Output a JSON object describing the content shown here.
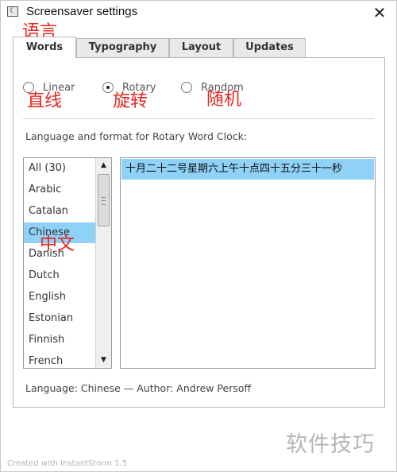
{
  "window": {
    "title": "Screensaver settings",
    "close_glyph": "✕",
    "app_icon": "screensaver-app-icon"
  },
  "tabs": [
    {
      "label": "Words",
      "active": true
    },
    {
      "label": "Typography",
      "active": false
    },
    {
      "label": "Layout",
      "active": false
    },
    {
      "label": "Updates",
      "active": false
    }
  ],
  "mode": {
    "options": [
      {
        "label": "Linear",
        "selected": false
      },
      {
        "label": "Rotary",
        "selected": true
      },
      {
        "label": "Random",
        "selected": false
      }
    ]
  },
  "section_label": "Language and format for Rotary Word Clock:",
  "languages": {
    "items": [
      "All (30)",
      "Arabic",
      "Catalan",
      "Chinese",
      "Danish",
      "Dutch",
      "English",
      "Estonian",
      "Finnish",
      "French"
    ],
    "selected": "Chinese"
  },
  "preview": {
    "text": "十月二十二号星期六上午十点四十五分三十一秒"
  },
  "footer": {
    "info": "Language: Chinese — Author: Andrew Persoff"
  },
  "annotations": {
    "tab_note": "语言",
    "linear_note": "直线",
    "rotary_note": "旋转",
    "random_note": "随机",
    "chinese_note": "中文"
  },
  "watermark": "软件技巧",
  "credit": "Created with InstantStorm 1.5",
  "colors": {
    "selection": "#8fd1f7",
    "annotation": "#e8251f"
  }
}
